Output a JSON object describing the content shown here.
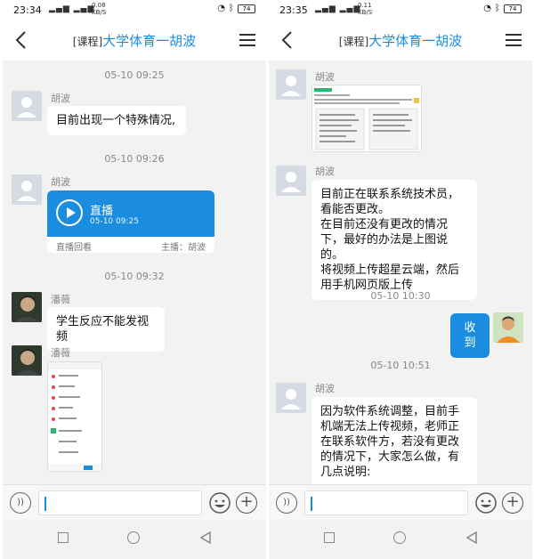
{
  "left": {
    "status": {
      "time": "23:34",
      "speed": "0.08\nKB/S",
      "battery": "74"
    },
    "title": {
      "tag": "[课程]",
      "text": "大学体育一胡波"
    },
    "messages": {
      "ts1": "05-10 09:25",
      "m1_sender": "胡波",
      "m1_text": "目前出现一个特殊情况,",
      "ts2": "05-10 09:26",
      "m2_sender": "胡波",
      "live_title": "直播",
      "live_time": "05-10 09:25",
      "live_replay": "直播回看",
      "live_host": "主播：胡波",
      "ts3": "05-10 09:32",
      "m3_sender": "潘薇",
      "m3_text": "学生反应不能发视频",
      "m4_sender": "潘薇"
    }
  },
  "right": {
    "status": {
      "time": "23:35",
      "speed": "0.11\nKB/S",
      "battery": "74"
    },
    "title": {
      "tag": "[课程]",
      "text": "大学体育一胡波"
    },
    "messages": {
      "m1_sender": "胡波",
      "m2_sender": "胡波",
      "m2_text": "目前正在联系系统技术员，看能否更改。\n在目前还没有更改的情况下，最好的办法是上图说的。\n将视频上传超星云端，然后用手机网页版上传",
      "ts1": "05-10 10:30",
      "m3_text": "收到",
      "ts2": "05-10 10:51",
      "m4_sender": "胡波",
      "m4_text": "因为软件系统调整，目前手机端无法上传视频，老师正在联系软件方，若没有更改的情况下，大家怎么做，有几点说明:"
    }
  },
  "colors": {
    "accent": "#1a8de0"
  }
}
